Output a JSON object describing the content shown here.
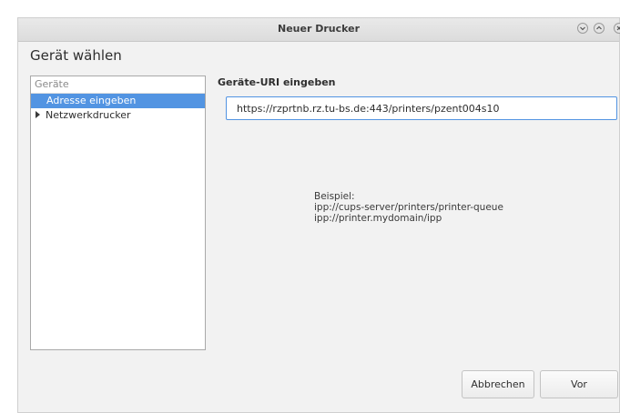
{
  "window": {
    "title": "Neuer Drucker"
  },
  "page": {
    "heading": "Gerät wählen"
  },
  "devices": {
    "header": "Geräte",
    "items": [
      {
        "label": "Adresse eingeben",
        "selected": true
      },
      {
        "label": "Netzwerkdrucker",
        "expandable": true
      }
    ]
  },
  "uri": {
    "label": "Geräte-URI eingeben",
    "value": "https://rzprtnb.rz.tu-bs.de:443/printers/pzent004s10"
  },
  "example": {
    "title": "Beispiel:",
    "lines": [
      "ipp://cups-server/printers/printer-queue",
      "ipp://printer.mydomain/ipp"
    ]
  },
  "buttons": {
    "cancel": "Abbrechen",
    "next": "Vor"
  },
  "colors": {
    "accent": "#5294e2",
    "background": "#f2f2f2"
  }
}
